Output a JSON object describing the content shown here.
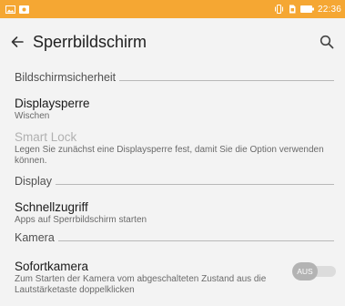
{
  "status_bar": {
    "time": "22:36",
    "left_icons": [
      "image-icon",
      "photo-icon"
    ],
    "right_icons": [
      "vibrate-icon",
      "sim-icon",
      "battery-icon"
    ],
    "background": "#f5a733"
  },
  "toolbar": {
    "title": "Sperrbildschirm"
  },
  "sections": {
    "security": {
      "header": "Bildschirmsicherheit"
    },
    "display": {
      "header": "Display"
    },
    "camera": {
      "header": "Kamera"
    }
  },
  "items": {
    "display_lock": {
      "title": "Displaysperre",
      "subtitle": "Wischen"
    },
    "smart_lock": {
      "title": "Smart Lock",
      "subtitle": "Legen Sie zunächst eine Displaysperre fest, damit Sie die Option verwenden können."
    },
    "quick_access": {
      "title": "Schnellzugriff",
      "subtitle": "Apps auf Sperrbildschirm starten"
    },
    "instant_camera": {
      "title": "Sofortkamera",
      "subtitle": "Zum Starten der Kamera vom abgeschalteten Zustand aus die Lautstärketaste doppelklicken",
      "toggle_label": "AUS",
      "toggle_on": false
    }
  }
}
